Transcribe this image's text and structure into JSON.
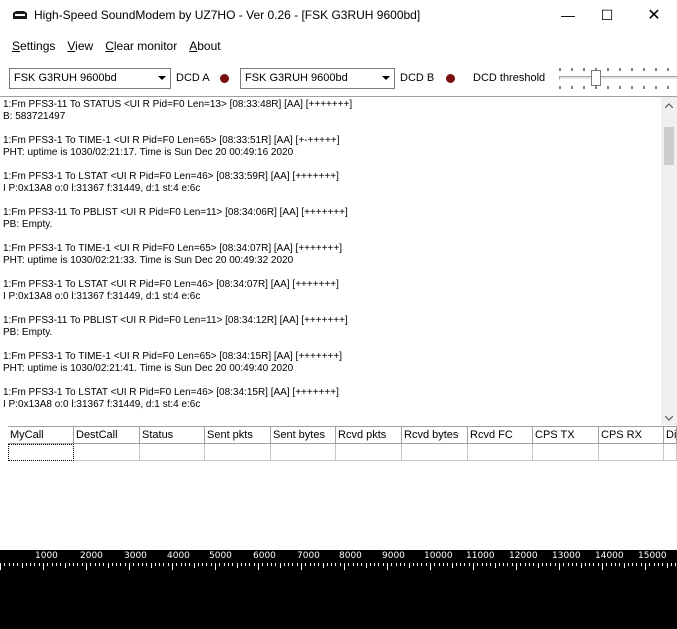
{
  "window": {
    "title": "High-Speed SoundModem by UZ7HO - Ver 0.26 - [FSK G3RUH 9600bd]",
    "minimize_icon": "minimize-icon",
    "maximize_icon": "maximize-icon",
    "close_icon": "close-icon",
    "minimize_glyph": "—",
    "maximize_glyph": "☐",
    "close_glyph": "✕"
  },
  "menu": {
    "settings": {
      "ul": "S",
      "rest": "ettings"
    },
    "view": {
      "ul": "V",
      "rest": "iew"
    },
    "clear_monitor": {
      "ul": "C",
      "rest": "lear monitor"
    },
    "about": {
      "ul": "A",
      "rest": "bout"
    }
  },
  "toolbar": {
    "modem_a": "FSK G3RUH 9600bd",
    "dcd_a_label": "DCD A",
    "modem_b": "FSK G3RUH 9600bd",
    "dcd_b_label": "DCD B",
    "dcd_threshold_label": "DCD threshold",
    "dcd_led_color": "#7a0d0d",
    "dcd_threshold_level": 0.3
  },
  "monitor": {
    "entries": [
      {
        "header": "1:Fm PFS3-11 To STATUS <UI R Pid=F0 Len=13> [08:33:48R] [AA] [+++++++]",
        "body": "B: 583721497"
      },
      {
        "header": "1:Fm PFS3-1 To TIME-1 <UI R Pid=F0 Len=65> [08:33:51R] [AA] [+-+++++]",
        "body": "PHT: uptime is 1030/02:21:17.  Time is Sun Dec 20 00:49:16 2020"
      },
      {
        "header": "1:Fm PFS3-1 To LSTAT <UI R Pid=F0 Len=46> [08:33:59R] [AA] [+++++++]",
        "body": "I P:0x13A8 o:0 l:31367 f:31449, d:1 st:4 e:6c"
      },
      {
        "header": "1:Fm PFS3-11 To PBLIST <UI R Pid=F0 Len=11> [08:34:06R] [AA] [+++++++]",
        "body": "PB: Empty."
      },
      {
        "header": "1:Fm PFS3-1 To TIME-1 <UI R Pid=F0 Len=65> [08:34:07R] [AA] [+++++++]",
        "body": "PHT: uptime is 1030/02:21:33.  Time is Sun Dec 20 00:49:32 2020"
      },
      {
        "header": "1:Fm PFS3-1 To LSTAT <UI R Pid=F0 Len=46> [08:34:07R] [AA] [+++++++]",
        "body": "I P:0x13A8 o:0 l:31367 f:31449, d:1 st:4 e:6c"
      },
      {
        "header": "1:Fm PFS3-11 To PBLIST <UI R Pid=F0 Len=11> [08:34:12R] [AA] [+++++++]",
        "body": "PB: Empty."
      },
      {
        "header": "1:Fm PFS3-1 To TIME-1 <UI R Pid=F0 Len=65> [08:34:15R] [AA] [+++++++]",
        "body": "PHT: uptime is 1030/02:21:41.  Time is Sun Dec 20 00:49:40 2020"
      },
      {
        "header": "1:Fm PFS3-1 To LSTAT <UI R Pid=F0 Len=46> [08:34:15R] [AA] [+++++++]",
        "body": "I P:0x13A8 o:0 l:31367 f:31449, d:1 st:4 e:6c"
      }
    ]
  },
  "grid": {
    "columns": [
      "MyCall",
      "DestCall",
      "Status",
      "Sent pkts",
      "Sent bytes",
      "Rcvd pkts",
      "Rcvd bytes",
      "Rcvd FC",
      "CPS TX",
      "CPS RX",
      "Di"
    ]
  },
  "waterfall": {
    "scale_labels": [
      "1000",
      "2000",
      "3000",
      "4000",
      "5000",
      "6000",
      "7000",
      "8000",
      "9000",
      "10000",
      "11000",
      "12000",
      "13000",
      "14000",
      "15000"
    ]
  }
}
